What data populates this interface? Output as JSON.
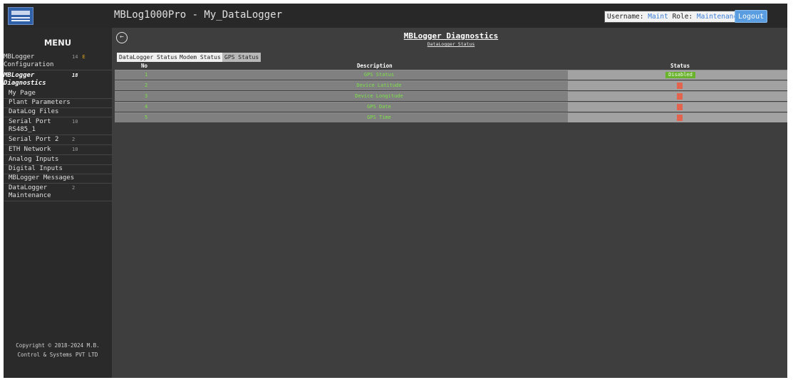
{
  "header": {
    "title": "MBLog1000Pro - My_DataLogger",
    "username_label": "Username:",
    "username": "Maint",
    "role_label": "Role:",
    "role": "Maintenance",
    "logout": "Logout"
  },
  "sidebar": {
    "title": "MENU",
    "config_line1": "MBLogger",
    "config_line2": "Configuration",
    "config_badge": "14",
    "config_badge_e": "E",
    "diag_line1": "MBLogger",
    "diag_line2": "Diagnostics",
    "diag_badge": "18",
    "items": [
      {
        "label": "My Page"
      },
      {
        "label": "Plant Parameters"
      },
      {
        "label": "DataLog Files"
      },
      {
        "label": "Serial Port",
        "label2": "RS485_1",
        "badge": "10"
      },
      {
        "label": "Serial Port 2",
        "badge": "2"
      },
      {
        "label": "ETH Network",
        "badge": "10"
      },
      {
        "label": "Analog Inputs"
      },
      {
        "label": "Digital Inputs"
      },
      {
        "label": "MBLogger Messages"
      },
      {
        "label": "DataLogger",
        "label2": "Maintenance",
        "badge": "2"
      }
    ],
    "copyright_line1": "Copyright © 2018-2024 M.B.",
    "copyright_line2": "Control & Systems PVT LTD"
  },
  "main": {
    "title": "MBLogger Diagnostics",
    "subtitle": "DataLogger Status",
    "back_icon": "arrow-left-circle-icon",
    "tabs": [
      {
        "label": "DataLogger Status",
        "active": false
      },
      {
        "label": "Modem Status",
        "active": false
      },
      {
        "label": "GPS Status",
        "active": true
      }
    ],
    "table": {
      "columns": [
        "No",
        "Description",
        "Status"
      ],
      "rows": [
        {
          "no": "1",
          "description": "GPS Status",
          "status": "Disabled"
        },
        {
          "no": "2",
          "description": "Device Latitude",
          "status": "red-indicator"
        },
        {
          "no": "3",
          "description": "Device Longitude",
          "status": "red-indicator"
        },
        {
          "no": "4",
          "description": "GPS Date",
          "status": "red-indicator"
        },
        {
          "no": "5",
          "description": "GPS Time",
          "status": "red-indicator"
        }
      ]
    }
  },
  "colors": {
    "background": "#3e3e3e",
    "sidebar": "#2a2a2a",
    "row_text": "#7de14a",
    "status_disabled": "#6ab42d",
    "status_red": "#e2644f",
    "logout_button": "#5a9de0"
  }
}
